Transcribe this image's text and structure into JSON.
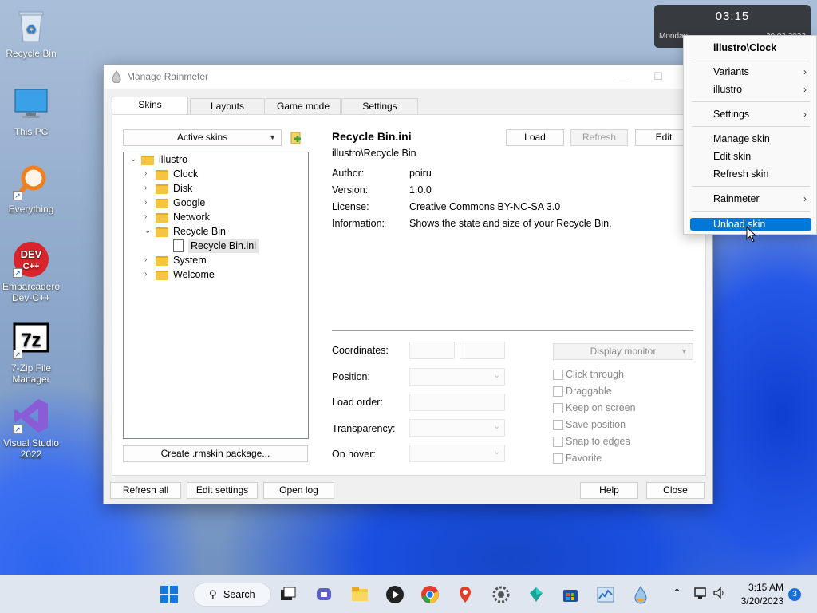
{
  "desktop": {
    "icons": [
      {
        "label": "Recycle Bin"
      },
      {
        "label": "This PC"
      },
      {
        "label": "Everything"
      },
      {
        "label": "Embarcadero Dev-C++"
      },
      {
        "label": "7-Zip File Manager"
      },
      {
        "label": "Visual Studio 2022"
      }
    ]
  },
  "clock_widget": {
    "time": "03:15",
    "day": "Monday",
    "date": "20.03.2023"
  },
  "window": {
    "title": "Manage Rainmeter",
    "tabs": [
      "Skins",
      "Layouts",
      "Game mode",
      "Settings"
    ],
    "active_tab": "Skins",
    "skins_dropdown": "Active skins",
    "tree": {
      "root": "illustro",
      "items": [
        "Clock",
        "Disk",
        "Google",
        "Network",
        "Recycle Bin",
        "System",
        "Welcome"
      ],
      "expanded": "Recycle Bin",
      "child": "Recycle Bin.ini"
    },
    "create_button": "Create .rmskin package...",
    "skin": {
      "file": "Recycle Bin.ini",
      "path": "illustro\\Recycle Bin",
      "author_label": "Author:",
      "author": "poiru",
      "version_label": "Version:",
      "version": "1.0.0",
      "license_label": "License:",
      "license": "Creative Commons BY-NC-SA 3.0",
      "information_label": "Information:",
      "information": "Shows the state and size of your Recycle Bin."
    },
    "skin_buttons": {
      "load": "Load",
      "refresh": "Refresh",
      "edit": "Edit"
    },
    "settings": {
      "coordinates": "Coordinates:",
      "position": "Position:",
      "load_order": "Load order:",
      "transparency": "Transparency:",
      "on_hover": "On hover:",
      "display_monitor": "Display monitor",
      "checkboxes": [
        "Click through",
        "Draggable",
        "Keep on screen",
        "Save position",
        "Snap to edges",
        "Favorite"
      ]
    },
    "footer": {
      "refresh_all": "Refresh all",
      "edit_settings": "Edit settings",
      "open_log": "Open log",
      "help": "Help",
      "close": "Close"
    }
  },
  "context_menu": {
    "header": "illustro\\Clock",
    "items": [
      "Variants",
      "illustro",
      "Settings",
      "Manage skin",
      "Edit skin",
      "Refresh skin",
      "Rainmeter",
      "Unload skin"
    ],
    "highlighted": "Unload skin",
    "submenu_arrow": "›"
  },
  "taskbar": {
    "search_label": "Search",
    "time": "3:15 AM",
    "date": "3/20/2023",
    "notification_count": "3"
  }
}
